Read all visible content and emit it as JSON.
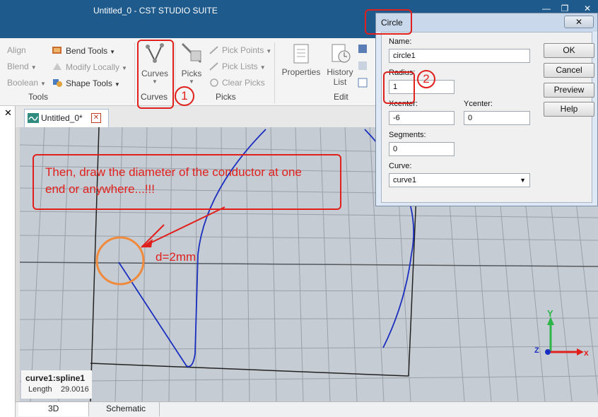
{
  "window": {
    "title": "Untitled_0 - CST STUDIO SUITE"
  },
  "ribbon": {
    "tools": {
      "align": "Align",
      "blend": "Blend",
      "boolean": "Boolean",
      "bend_tools": "Bend Tools",
      "modify_locally": "Modify Locally",
      "shape_tools": "Shape Tools",
      "group_label": "Tools"
    },
    "curves": {
      "button_label": "Curves",
      "group_label": "Curves"
    },
    "picks": {
      "button_label": "Picks",
      "pick_points": "Pick Points",
      "pick_lists": "Pick Lists",
      "clear_picks": "Clear Picks",
      "group_label": "Picks"
    },
    "edit": {
      "properties": "Properties",
      "history_line1": "History",
      "history_line2": "List",
      "group_label": "Edit"
    }
  },
  "document_tab": {
    "label": "Untitled_0*"
  },
  "viewport": {
    "annotation_text_line1": "Then, draw the diameter of the conductor at one",
    "annotation_text_line2": "end or anywhere...!!!",
    "diameter_label": "d=2mm",
    "axis_y": "Y",
    "axis_x": "x",
    "axis_z": "Z",
    "info_name": "curve1:spline1",
    "info_length_label": "Length",
    "info_length_value": "29.0016"
  },
  "bottom_tabs": [
    "3D",
    "Schematic"
  ],
  "dialog": {
    "title": "Circle",
    "name_label": "Name:",
    "name_value": "circle1",
    "radius_label": "Radius:",
    "radius_value": "1",
    "xcenter_label": "Xcenter:",
    "xcenter_value": "-6",
    "ycenter_label": "Ycenter:",
    "ycenter_value": "0",
    "segments_label": "Segments:",
    "segments_value": "0",
    "curve_label": "Curve:",
    "curve_value": "curve1",
    "ok": "OK",
    "cancel": "Cancel",
    "preview": "Preview",
    "help": "Help"
  },
  "step_markers": [
    "1",
    "2"
  ],
  "colors": {
    "annotation": "#e0201c",
    "orange_circle": "#f08a3c",
    "curve": "#1a2fbf",
    "titlebar": "#1e5a8c"
  }
}
